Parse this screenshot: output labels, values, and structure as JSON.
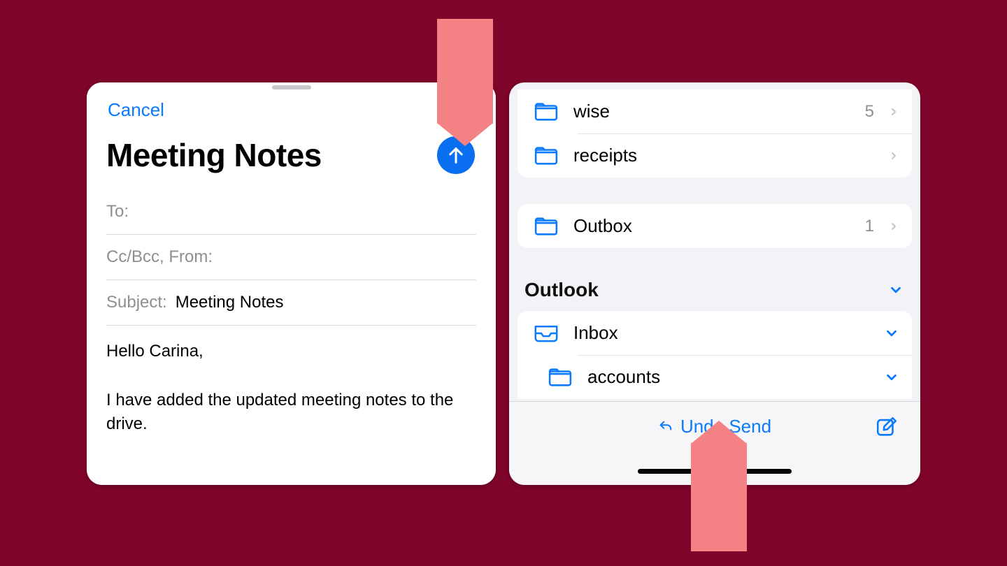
{
  "colors": {
    "accent": "#0a7aff",
    "background": "#80052a",
    "callout": "#f48284"
  },
  "compose": {
    "cancel_label": "Cancel",
    "title": "Meeting Notes",
    "to_label": "To:",
    "to_value": "",
    "cc_label": "Cc/Bcc, From:",
    "cc_value": "",
    "subject_label": "Subject:",
    "subject_value": "Meeting Notes",
    "body": "Hello Carina,\n\nI have added the updated meeting notes to the drive.\n"
  },
  "mailboxes": {
    "group_top": [
      {
        "icon": "folder-icon",
        "name": "wise",
        "count": "5",
        "disclosure": "chevron"
      },
      {
        "icon": "folder-icon",
        "name": "receipts",
        "count": "",
        "disclosure": "chevron"
      }
    ],
    "group_outbox": [
      {
        "icon": "folder-icon",
        "name": "Outbox",
        "count": "1",
        "disclosure": "chevron"
      }
    ],
    "section_title": "Outlook",
    "group_outlook": [
      {
        "icon": "tray-icon",
        "name": "Inbox",
        "count": "",
        "disclosure": "chevron-down",
        "indent": false
      },
      {
        "icon": "folder-icon",
        "name": "accounts",
        "count": "",
        "disclosure": "chevron-down",
        "indent": true
      }
    ]
  },
  "toolbar": {
    "undo_label": "Undo Send"
  }
}
